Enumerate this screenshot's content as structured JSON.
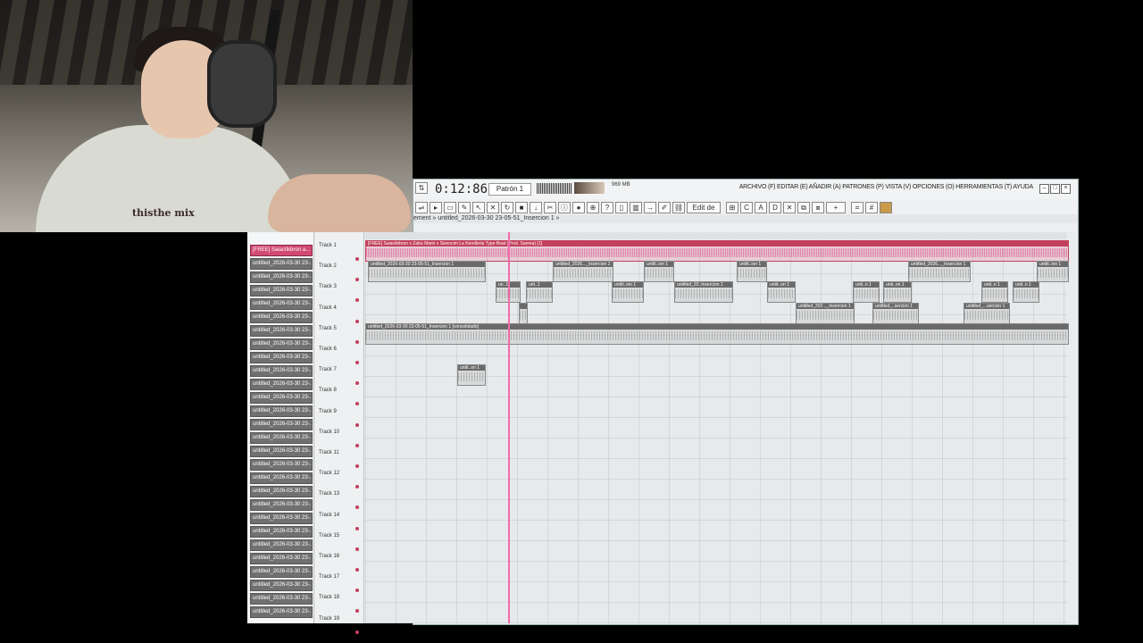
{
  "toolbar": {
    "time_display": "0:12:86",
    "pattern_label": "Patrón 1",
    "menu_text": "ARCHIVO (F) EDITAR (E) AÑADIR (A) PATRONES (P) VISTA (V) OPCIONES (O) HERRAMIENTAS (T) AYUDA",
    "cpu_text": "969 MB",
    "snap_label": "Edit de pat"
  },
  "breadcrumb": "ement » untitled_2026-03-30 23-05-51_Insercion 1 »",
  "webcam_shirt_text": "thisthe mix",
  "browser_items": [
    {
      "label": "[FREE] Saiactikbron a...",
      "audio": true
    },
    {
      "label": "untitled_2026-03-30 23-...",
      "audio": false
    },
    {
      "label": "untitled_2026-03-30 23-...",
      "audio": false
    },
    {
      "label": "untitled_2026-03-30 23-...",
      "audio": false
    },
    {
      "label": "untitled_2026-03-30 23-...",
      "audio": false
    },
    {
      "label": "untitled_2026-03-30 23-...",
      "audio": false
    },
    {
      "label": "untitled_2026-03-30 23-...",
      "audio": false
    },
    {
      "label": "untitled_2026-03-30 23-...",
      "audio": false
    },
    {
      "label": "untitled_2026-03-30 23-...",
      "audio": false
    },
    {
      "label": "untitled_2026-03-30 23-...",
      "audio": false
    },
    {
      "label": "untitled_2026-03-30 23-...",
      "audio": false
    },
    {
      "label": "untitled_2026-03-30 23-...",
      "audio": false
    },
    {
      "label": "untitled_2026-03-30 23-...",
      "audio": false
    },
    {
      "label": "untitled_2026-03-30 23-...",
      "audio": false
    },
    {
      "label": "untitled_2026-03-30 23-...",
      "audio": false
    },
    {
      "label": "untitled_2026-03-30 23-...",
      "audio": false
    },
    {
      "label": "untitled_2026-03-30 23-...",
      "audio": false
    },
    {
      "label": "untitled_2026-03-30 23-...",
      "audio": false
    },
    {
      "label": "untitled_2026-03-30 23-...",
      "audio": false
    },
    {
      "label": "untitled_2026-03-30 23-...",
      "audio": false
    },
    {
      "label": "untitled_2026-03-30 23-...",
      "audio": false
    },
    {
      "label": "untitled_2026-03-30 23-...",
      "audio": false
    },
    {
      "label": "untitled_2026-03-30 23-...",
      "audio": false
    },
    {
      "label": "untitled_2026-03-30 23-...",
      "audio": false
    },
    {
      "label": "untitled_2026-03-30 23-...",
      "audio": false
    },
    {
      "label": "untitled_2026-03-30 23-...",
      "audio": false
    },
    {
      "label": "untitled_2026-03-30 23-...",
      "audio": false
    },
    {
      "label": "untitled_2026-03-30 23-...",
      "audio": false
    }
  ],
  "tracks": [
    "Track 1",
    "Track 2",
    "Track 3",
    "Track 4",
    "Track 5",
    "Track 6",
    "Track 7",
    "Track 8",
    "Track 9",
    "Track 10",
    "Track 11",
    "Track 12",
    "Track 13",
    "Track 14",
    "Track 15",
    "Track 16",
    "Track 17",
    "Track 18",
    "Track 19"
  ],
  "clips": [
    {
      "track": 0,
      "start": 0,
      "len": 786,
      "label": "[FREE] Saiactikbron x Zabu Mami x Sivencim La Kendleria Type Beat (Prod. Sanma) [1]",
      "audio": true
    },
    {
      "track": 1,
      "start": 3,
      "len": 130,
      "label": "untitled_2026-03-30 23-05-51_Insercion 1",
      "audio": false
    },
    {
      "track": 1,
      "start": 210,
      "len": 66,
      "label": "untitled_2026..._Insercion 1",
      "audio": false
    },
    {
      "track": 1,
      "start": 312,
      "len": 32,
      "label": "untitl..ion 1",
      "audio": false
    },
    {
      "track": 1,
      "start": 416,
      "len": 32,
      "label": "untitl..ion 1",
      "audio": false
    },
    {
      "track": 1,
      "start": 608,
      "len": 68,
      "label": "untitled_2026..._Insercion 1",
      "audio": false
    },
    {
      "track": 1,
      "start": 752,
      "len": 34,
      "label": "untitl..ion 1",
      "audio": false
    },
    {
      "track": 2,
      "start": 146,
      "len": 26,
      "label": "un..1",
      "audio": false
    },
    {
      "track": 2,
      "start": 180,
      "len": 28,
      "label": "unt..1",
      "audio": false
    },
    {
      "track": 2,
      "start": 276,
      "len": 34,
      "label": "untitl..ion 1",
      "audio": false
    },
    {
      "track": 2,
      "start": 346,
      "len": 64,
      "label": "untitled_20..Insercion 1",
      "audio": false
    },
    {
      "track": 2,
      "start": 450,
      "len": 30,
      "label": "untit..on 1",
      "audio": false
    },
    {
      "track": 2,
      "start": 546,
      "len": 28,
      "label": "unti..n 1",
      "audio": false
    },
    {
      "track": 2,
      "start": 580,
      "len": 30,
      "label": "unti..on 1",
      "audio": false
    },
    {
      "track": 2,
      "start": 690,
      "len": 28,
      "label": "unti..n 1",
      "audio": false
    },
    {
      "track": 2,
      "start": 725,
      "len": 28,
      "label": "unti..n 1",
      "audio": false
    },
    {
      "track": 3,
      "start": 172,
      "len": 8,
      "label": "",
      "audio": false
    },
    {
      "track": 3,
      "start": 482,
      "len": 64,
      "label": "untitled_202..._Insercion 1",
      "audio": false
    },
    {
      "track": 3,
      "start": 568,
      "len": 50,
      "label": "untitled_..sercion 1",
      "audio": false
    },
    {
      "track": 3,
      "start": 670,
      "len": 50,
      "label": "untitled_...sercion 1",
      "audio": false
    },
    {
      "track": 4,
      "start": 0,
      "len": 786,
      "label": "untitled_2026-03-30 23-05-51_Insercion 1 [consolidado]",
      "audio": false
    },
    {
      "track": 6,
      "start": 103,
      "len": 30,
      "label": "untit..on 1",
      "audio": false
    }
  ]
}
